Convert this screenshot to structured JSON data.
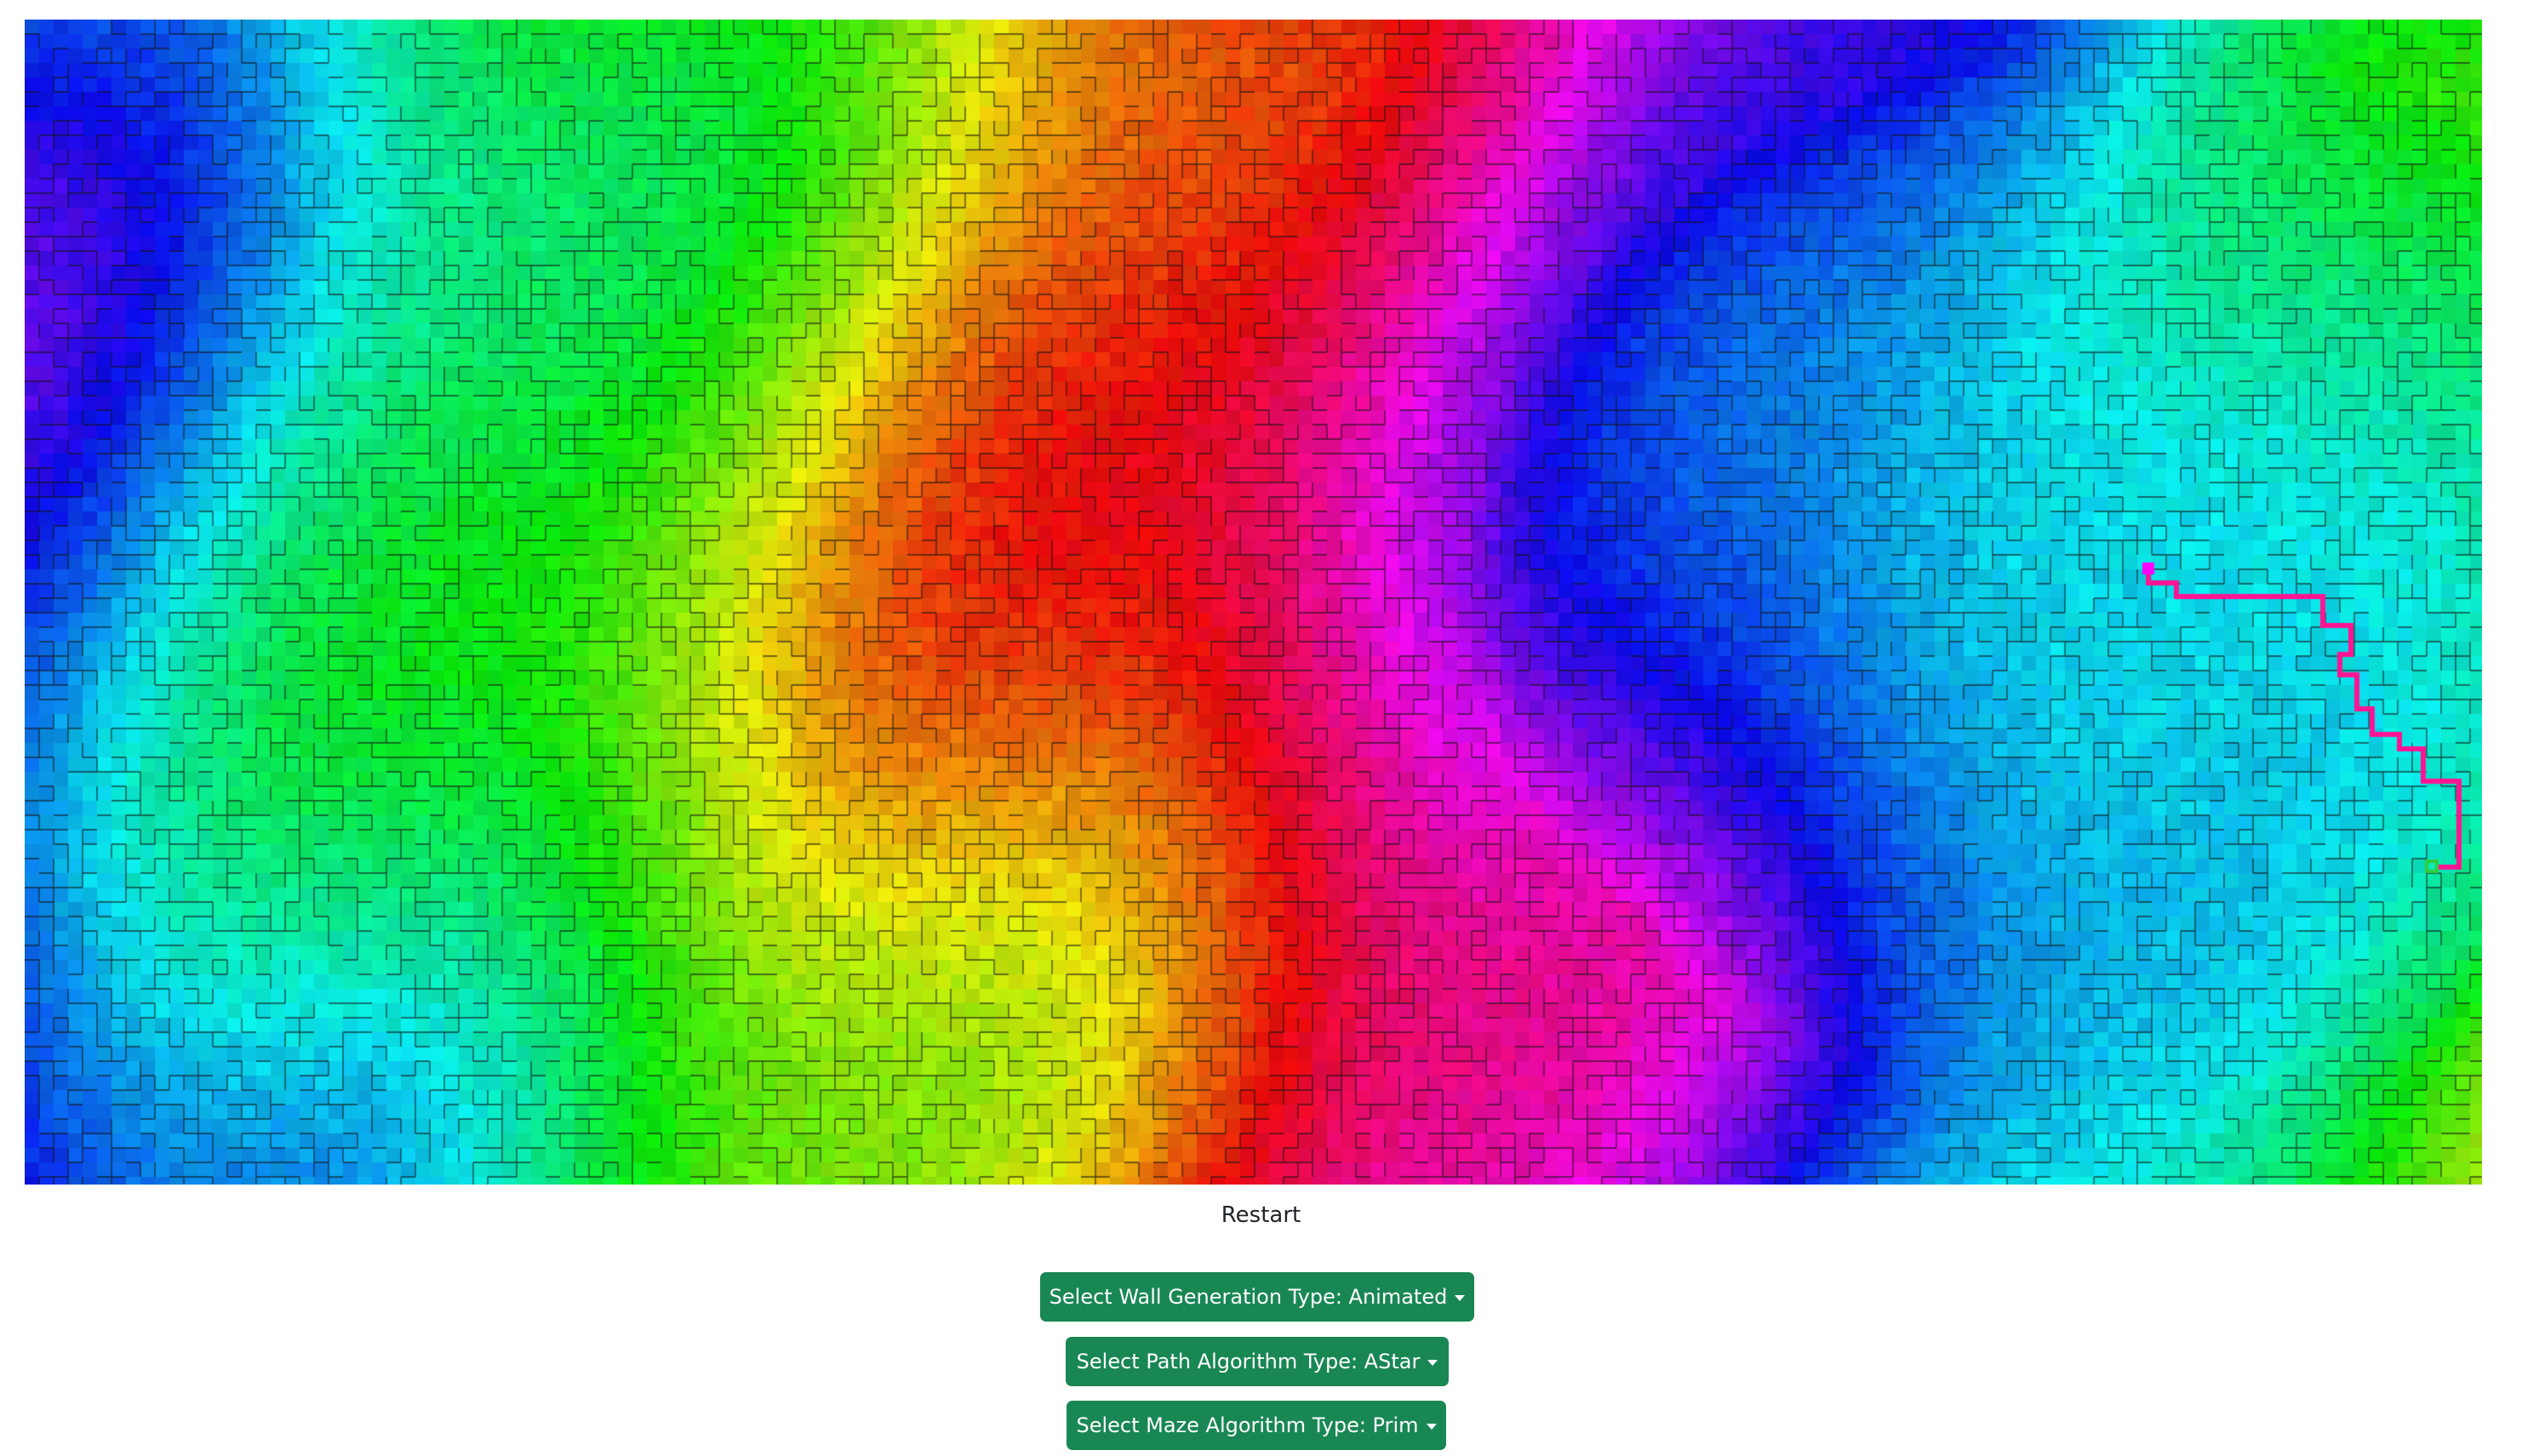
{
  "maze": {
    "start_color": "#ff00ff",
    "goal_color": "#2ecc40",
    "path_color": "#ff1493",
    "wall_color": "#1a1a1a",
    "hue_gradient": [
      "#1e1ecc",
      "#00d0e0",
      "#00d000",
      "#e0e000",
      "#e00000",
      "#e000e0",
      "#7000e0",
      "#0000e0"
    ]
  },
  "controls": {
    "restart_label": "Restart",
    "wall_generation_label": "Select Wall Generation Type: Animated",
    "path_algorithm_label": "Select Path Algorithm Type: AStar",
    "maze_algorithm_label": "Select Maze Algorithm Type: Prim",
    "button_color": "#198754"
  }
}
